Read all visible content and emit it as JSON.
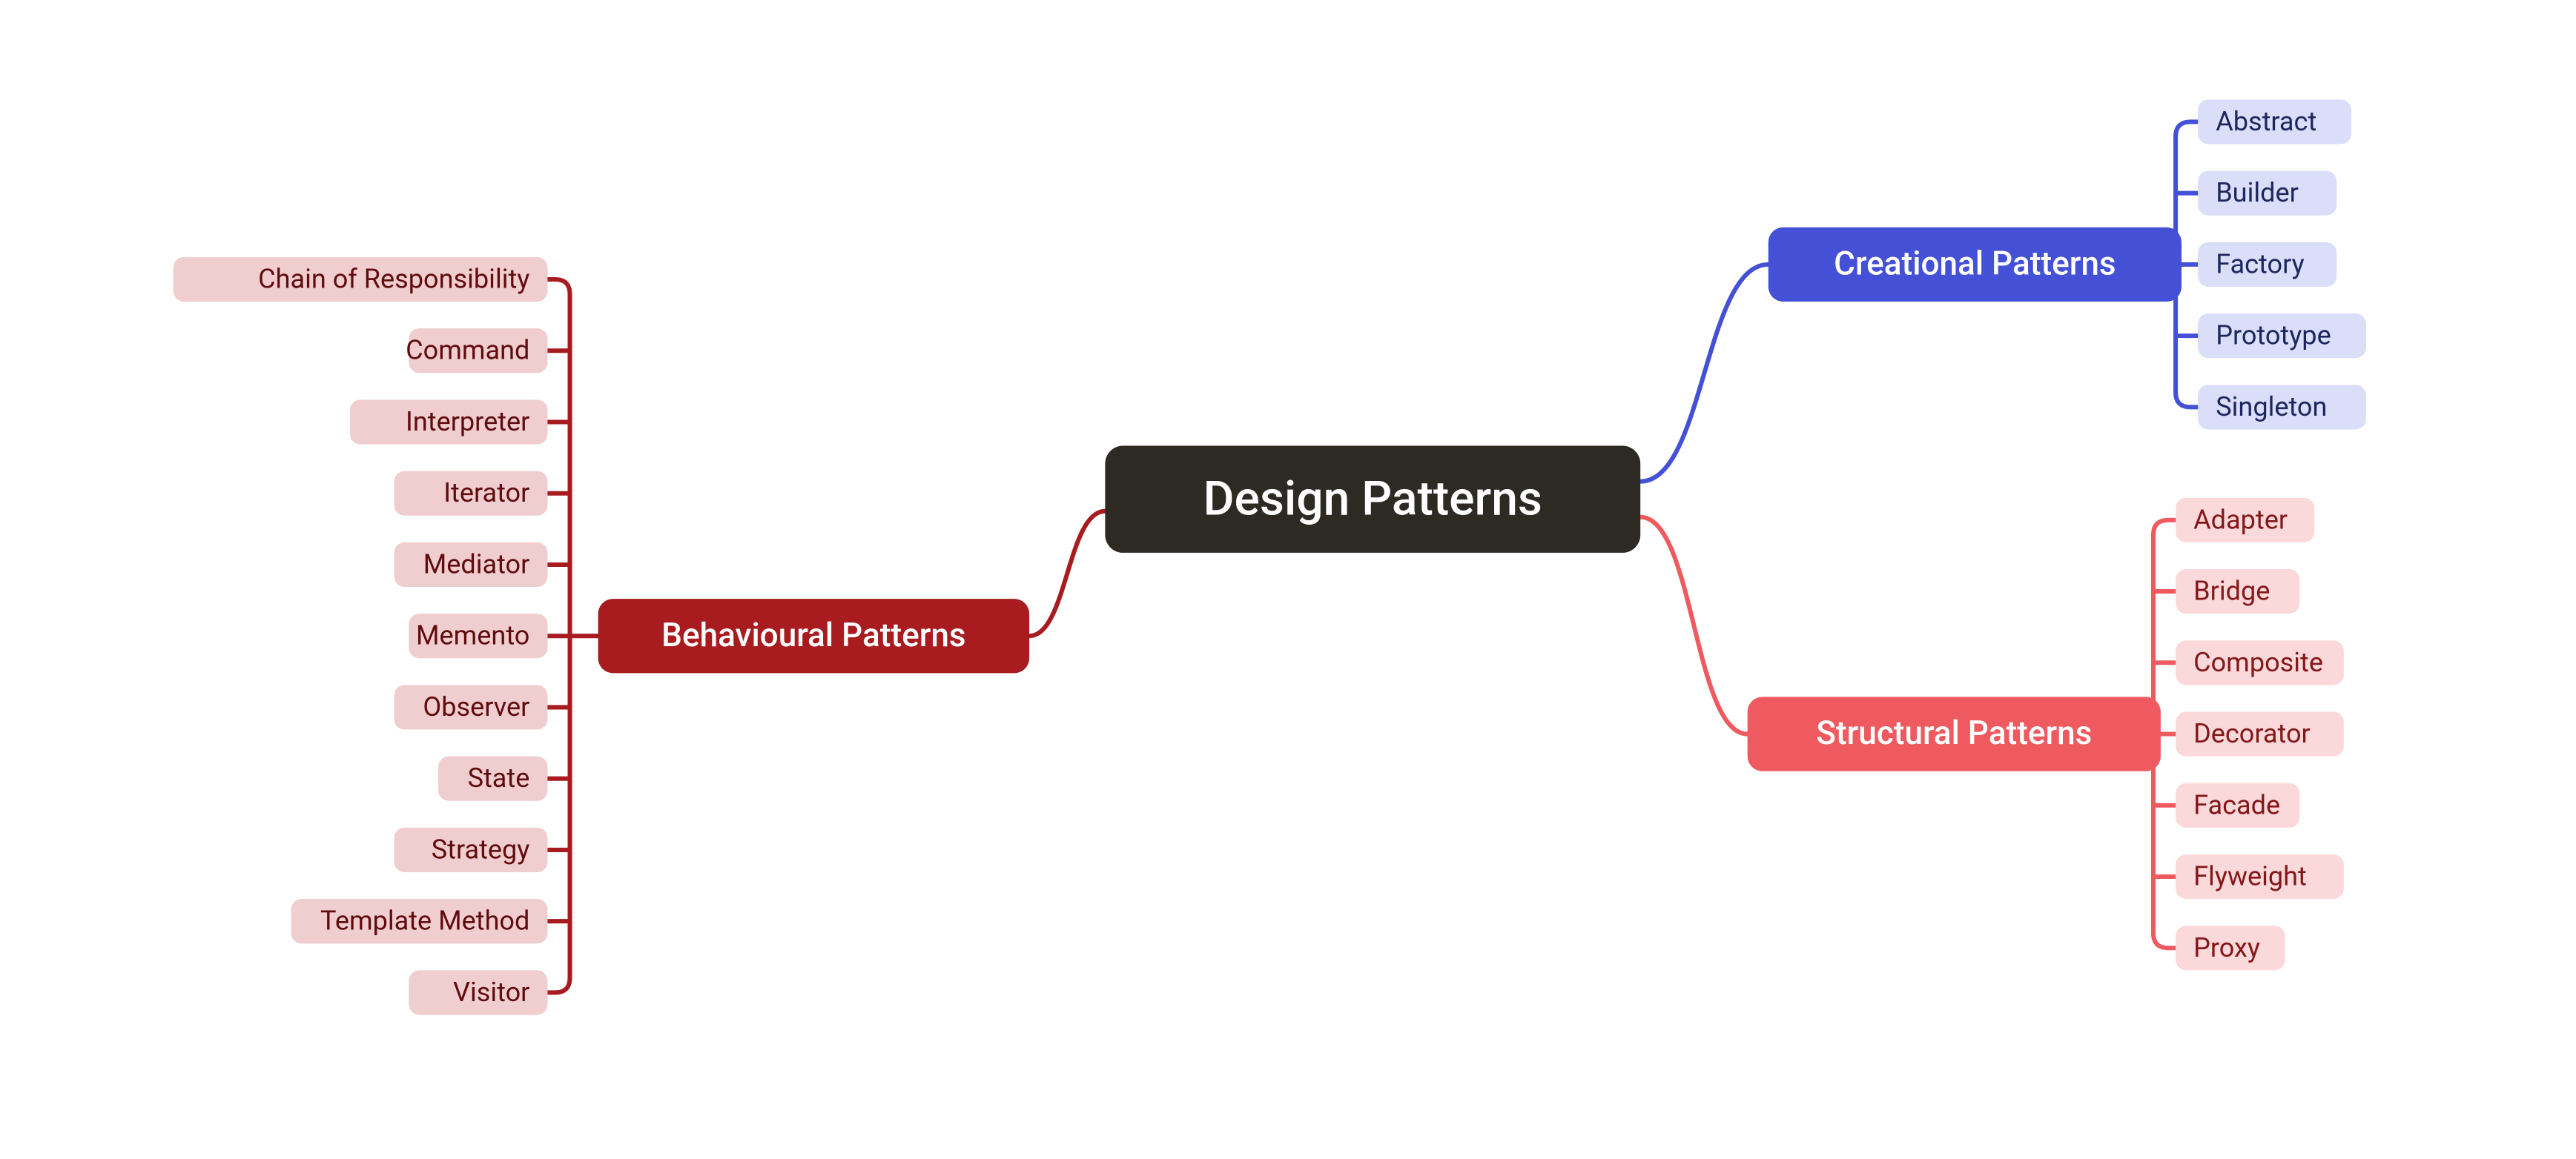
{
  "root": {
    "label": "Design Patterns"
  },
  "branches": {
    "creational": {
      "label": "Creational Patterns",
      "color": "#4450d5",
      "leafFill": "#dadef8",
      "leafText": "#1c2760",
      "leaves": [
        "Abstract",
        "Builder",
        "Factory",
        "Prototype",
        "Singleton"
      ]
    },
    "structural": {
      "label": "Structural Patterns",
      "color": "#ee5a5f",
      "leafFill": "#fbd9da",
      "leafText": "#83171a",
      "leaves": [
        "Adapter",
        "Bridge",
        "Composite",
        "Decorator",
        "Facade",
        "Flyweight",
        "Proxy"
      ]
    },
    "behavioural": {
      "label": "Behavioural Patterns",
      "color": "#a81b1f",
      "leafFill": "#f0cecf",
      "leafText": "#600b0e",
      "leaves": [
        "Chain of Responsibility",
        "Command",
        "Interpreter",
        "Iterator",
        "Mediator",
        "Memento",
        "Observer",
        "State",
        "Strategy",
        "Template Method",
        "Visitor"
      ]
    }
  }
}
